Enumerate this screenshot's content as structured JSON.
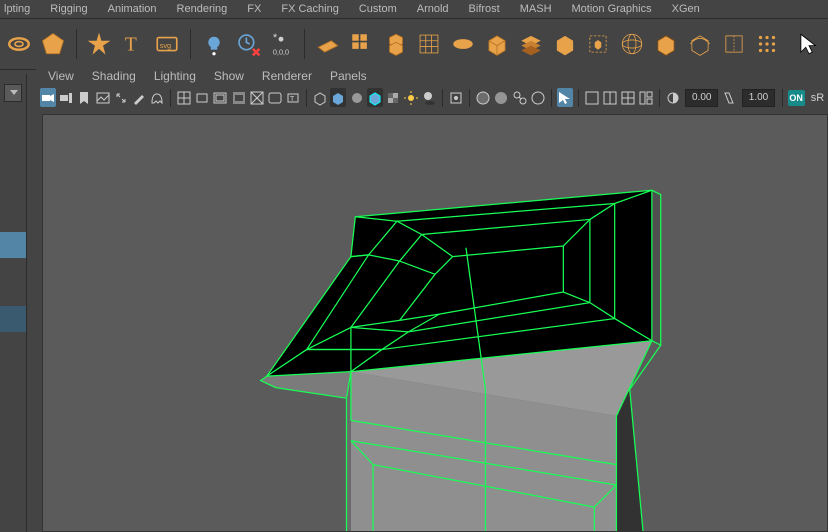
{
  "top_menus": [
    "lpting",
    "Rigging",
    "Animation",
    "Rendering",
    "FX",
    "FX Caching",
    "Custom",
    "Arnold",
    "Bifrost",
    "MASH",
    "Motion Graphics",
    "XGen"
  ],
  "panel_menus": [
    "View",
    "Shading",
    "Lighting",
    "Show",
    "Renderer",
    "Panels"
  ],
  "exposure_value": "0.00",
  "gamma_value": "1.00",
  "on_label": "ON",
  "sr_label": "sR"
}
